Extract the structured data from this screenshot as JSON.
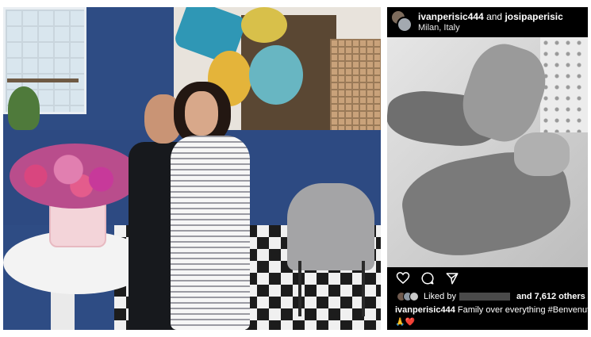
{
  "post": {
    "username_1": "ivanperisic444",
    "joiner": "and",
    "username_2": "josipaperisic",
    "location": "Milan, Italy",
    "liked_prefix": "Liked by",
    "liked_suffix": "and 7,612 others",
    "caption_user": "ivanperisic444",
    "caption_text": "Family over everything  #Benvenuto",
    "emoji_line": "🙏❤️"
  },
  "icons": [
    "heart-icon",
    "comment-icon",
    "share-icon"
  ],
  "colors": {
    "post_background": "#000000",
    "text": "#ffffff",
    "heart_emoji": "#e0243a"
  }
}
